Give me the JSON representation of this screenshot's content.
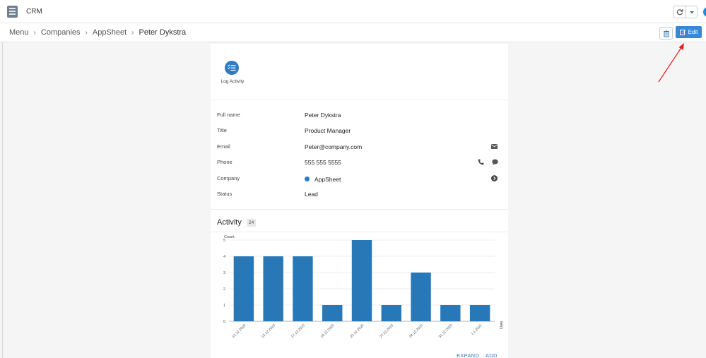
{
  "app": {
    "title": "CRM",
    "icon": "app-logo-icon"
  },
  "header": {
    "sync_icon": "sync-icon",
    "menu_icon": "chevron-down-icon"
  },
  "breadcrumb": {
    "items": [
      "Menu",
      "Companies",
      "AppSheet",
      "Peter Dykstra"
    ]
  },
  "toolbar": {
    "edit_label": "Edit",
    "delete_icon": "trash-icon",
    "edit_icon": "edit-icon",
    "accent": "#3a87d3"
  },
  "actions": {
    "log_activity_label": "Log Activity",
    "log_activity_icon": "checklist-icon"
  },
  "details": {
    "fields": [
      {
        "label": "Full name",
        "value": "Peter Dykstra"
      },
      {
        "label": "Title",
        "value": "Product Manager"
      },
      {
        "label": "Email",
        "value": "Peter@company.com",
        "icon": "mail-icon"
      },
      {
        "label": "Phone",
        "value": "555 555 5555",
        "icons": [
          "phone-icon",
          "chat-icon"
        ]
      },
      {
        "label": "Company",
        "value": "AppSheet",
        "icon": "chevron-right-circle-icon"
      },
      {
        "label": "Status",
        "value": "Lead"
      }
    ]
  },
  "activity": {
    "title": "Activity",
    "count": "24",
    "expand_label": "EXPAND",
    "add_label": "ADD"
  },
  "chart_data": {
    "type": "bar",
    "ylabel": "Count",
    "xlabel": "Date",
    "categories": [
      "12.12.2020",
      "13.12.2020",
      "17.12.2020",
      "18.12.2020",
      "22.12.2020",
      "27.12.2020",
      "28.12.2020",
      "31.12.2020",
      "1.1.2021"
    ],
    "values": [
      4,
      4,
      4,
      1,
      5,
      1,
      3,
      1,
      1
    ],
    "ylim": [
      0,
      5
    ],
    "yticks": [
      0,
      1,
      2,
      3,
      4,
      5
    ],
    "grid": true,
    "bar_color": "#2878b8"
  }
}
